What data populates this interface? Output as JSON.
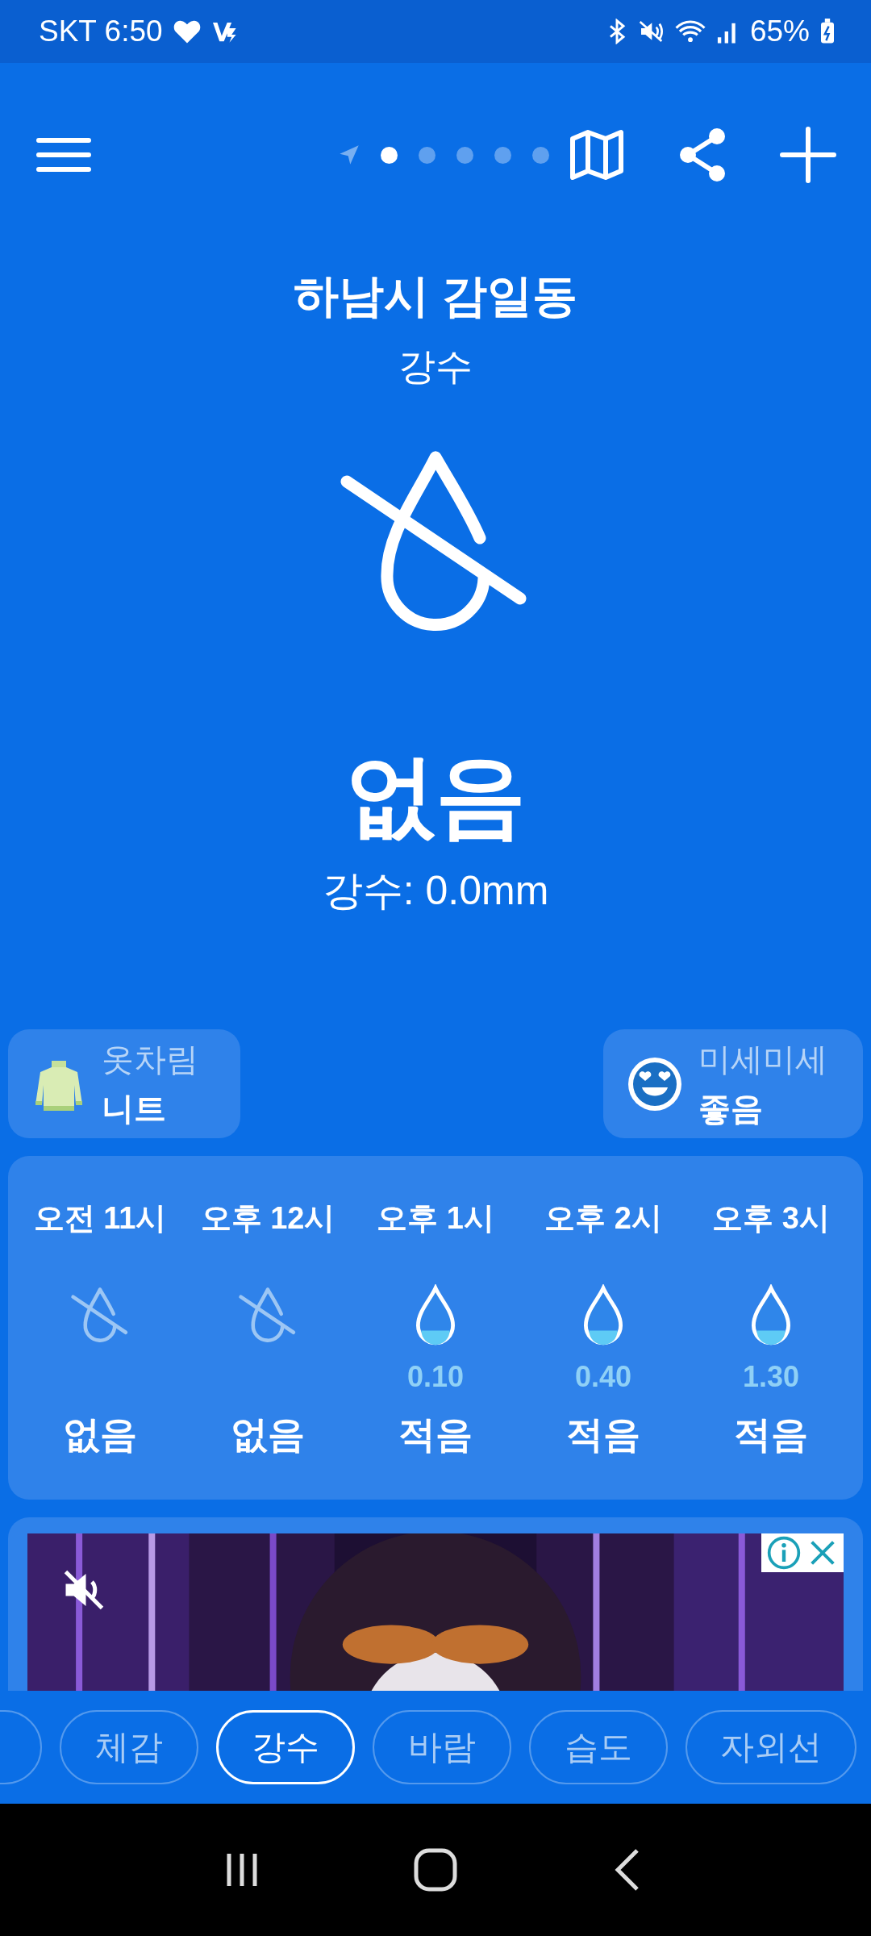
{
  "status_bar": {
    "carrier_time": "SKT 6:50",
    "battery": "65%"
  },
  "page_dots": [
    {
      "selected": true
    },
    {
      "selected": false
    },
    {
      "selected": false
    },
    {
      "selected": false
    },
    {
      "selected": false
    }
  ],
  "location": "하남시 감일동",
  "category": "강수",
  "current": {
    "kind": "none",
    "value": "없음",
    "detail": "강수: 0.0mm"
  },
  "cards": [
    {
      "kind": "clothing",
      "label": "옷차림",
      "value": "니트"
    },
    {
      "kind": "dust",
      "label": "미세미세",
      "value": "좋음"
    }
  ],
  "hourly": [
    {
      "time": "오전 11시",
      "kind": "none",
      "status": "없음"
    },
    {
      "time": "오후 12시",
      "kind": "none",
      "status": "없음"
    },
    {
      "time": "오후 1시",
      "kind": "drop",
      "amount": "0.10",
      "status": "적음"
    },
    {
      "time": "오후 2시",
      "kind": "drop",
      "amount": "0.40",
      "status": "적음"
    },
    {
      "time": "오후 3시",
      "kind": "drop",
      "amount": "1.30",
      "status": "적음"
    }
  ],
  "ad": {
    "kind": "picture",
    "muted": true
  },
  "tabs": [
    {
      "label": "체감",
      "selected": false
    },
    {
      "label": "강수",
      "selected": true
    },
    {
      "label": "바람",
      "selected": false
    },
    {
      "label": "습도",
      "selected": false
    },
    {
      "label": "자외선",
      "selected": false
    }
  ]
}
